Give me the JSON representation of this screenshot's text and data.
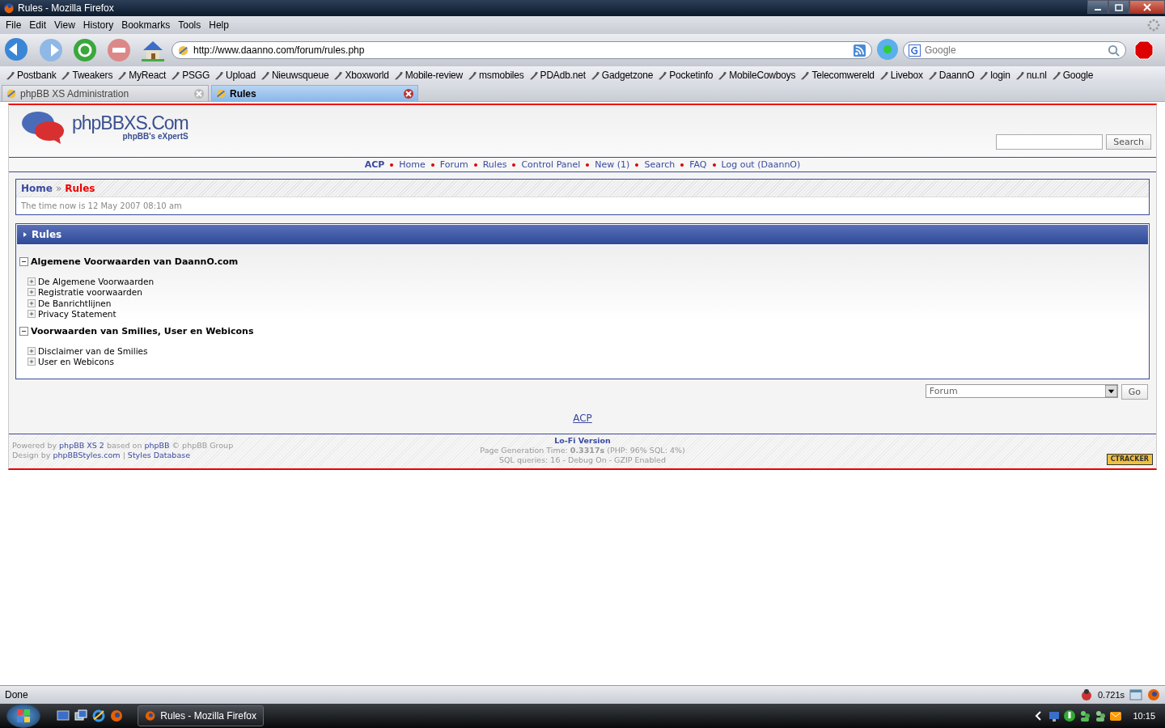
{
  "window": {
    "title": "Rules - Mozilla Firefox"
  },
  "menu": [
    "File",
    "Edit",
    "View",
    "History",
    "Bookmarks",
    "Tools",
    "Help"
  ],
  "address": {
    "value": "http://www.daanno.com/forum/rules.php"
  },
  "search_box": {
    "placeholder": "Google"
  },
  "bookmarks": [
    "Postbank",
    "Tweakers",
    "MyReact",
    "PSGG",
    "Upload",
    "Nieuwsqueue",
    "Xboxworld",
    "Mobile-review",
    "msmobiles",
    "PDAdb.net",
    "Gadgetzone",
    "Pocketinfo",
    "MobileCowboys",
    "Telecomwereld",
    "Livebox",
    "DaannO",
    "login",
    "nu.nl",
    "Google"
  ],
  "tabs": [
    {
      "label": "phpBB XS Administration",
      "selected": false
    },
    {
      "label": "Rules",
      "selected": true
    }
  ],
  "site": {
    "logo": "phpBBXS.Com",
    "tagline": "phpBB's eXpertS",
    "search_button": "Search"
  },
  "nav": [
    {
      "label": "ACP",
      "emphasized": true
    },
    {
      "label": "Home",
      "emphasized": false
    },
    {
      "label": "Forum",
      "emphasized": false
    },
    {
      "label": "Rules",
      "emphasized": false
    },
    {
      "label": "Control Panel",
      "emphasized": false
    },
    {
      "label": "New (1)",
      "emphasized": false
    },
    {
      "label": "Search",
      "emphasized": false
    },
    {
      "label": "FAQ",
      "emphasized": false
    },
    {
      "label": "Log out (DaannO)",
      "emphasized": false
    }
  ],
  "breadcrumb": {
    "home": "Home",
    "separator": "»",
    "current": "Rules",
    "time": "The time now is 12 May 2007 08:10 am"
  },
  "panel": {
    "title": "Rules",
    "sections": [
      {
        "label": "Algemene Voorwaarden van DaannO.com",
        "expanded": true,
        "children": [
          {
            "label": "De Algemene Voorwaarden",
            "expanded": false
          },
          {
            "label": "Registratie voorwaarden",
            "expanded": false
          },
          {
            "label": "De Banrichtlijnen",
            "expanded": false
          },
          {
            "label": "Privacy Statement",
            "expanded": false
          }
        ]
      },
      {
        "label": "Voorwaarden van Smilies, User en Webicons",
        "expanded": true,
        "children": [
          {
            "label": "Disclaimer van de Smilies",
            "expanded": false
          },
          {
            "label": "User en Webicons",
            "expanded": false
          }
        ]
      }
    ]
  },
  "jump": {
    "value": "Forum",
    "button": "Go"
  },
  "acp_link": "ACP",
  "footer": {
    "powered_prefix": "Powered by",
    "powered_link": "phpBB XS 2",
    "based_on": "based on",
    "phpbb_link": "phpBB",
    "group": "© phpBB Group",
    "design_prefix": "Design by",
    "design_link": "phpBBStyles.com",
    "separator": "|",
    "styles_link": "Styles Database",
    "lofi": "Lo-Fi Version",
    "generation": "Page Generation Time: **0.3317s** (PHP: 96% SQL: 4%)",
    "queries": "SQL queries: 16 - Debug On - GZIP Enabled",
    "badge": "CTRACKER"
  },
  "status_bar": {
    "text": "Done",
    "timing": "0.721s"
  },
  "taskbar": {
    "task": "Rules - Mozilla Firefox",
    "clock": "10:15"
  }
}
